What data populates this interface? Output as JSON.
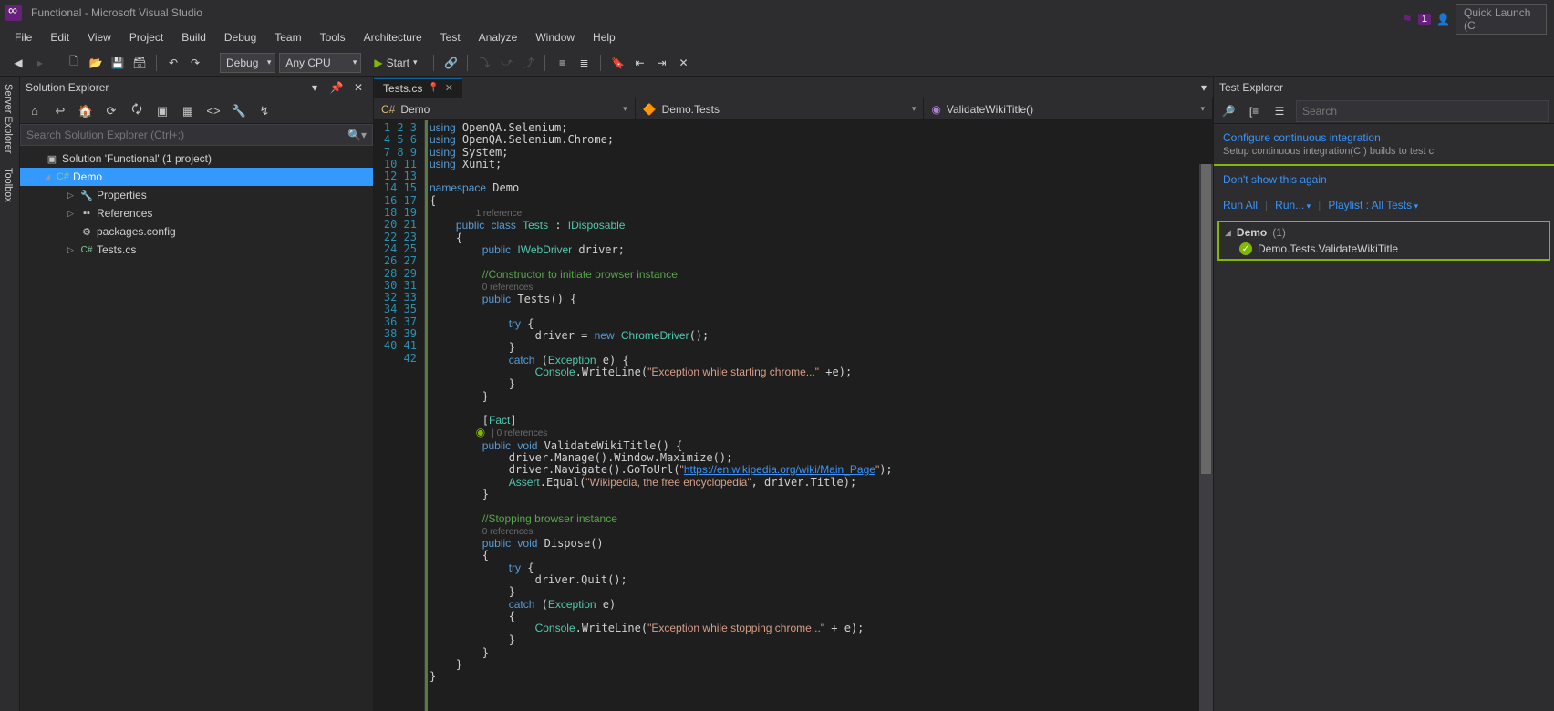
{
  "title": "Functional - Microsoft Visual Studio",
  "top_right": {
    "flag_badge": "1",
    "quick_launch": "Quick Launch (C"
  },
  "menu": [
    "File",
    "Edit",
    "View",
    "Project",
    "Build",
    "Debug",
    "Team",
    "Tools",
    "Architecture",
    "Test",
    "Analyze",
    "Window",
    "Help"
  ],
  "toolbar": {
    "config": "Debug",
    "platform": "Any CPU",
    "start_label": "Start"
  },
  "vertical_tabs": [
    "Server Explorer",
    "Toolbox"
  ],
  "solution_explorer": {
    "title": "Solution Explorer",
    "search_placeholder": "Search Solution Explorer (Ctrl+;)",
    "root": "Solution 'Functional' (1 project)",
    "project": "Demo",
    "items": [
      "Properties",
      "References",
      "packages.config",
      "Tests.cs"
    ]
  },
  "editor": {
    "tab": "Tests.cs",
    "nav": {
      "project": "Demo",
      "ns": "Demo.Tests",
      "member": "ValidateWikiTitle()"
    },
    "ref_1": "1 reference",
    "ref_0a": "0 references",
    "ref_0b": "| 0 references",
    "ref_0c": "0 references",
    "ref_0d": "0 references",
    "url": "https://en.wikipedia.org/wiki/Main_Page",
    "str_exstart": "\"Exception while starting chrome...\"",
    "str_exstop": "\"Exception while stopping chrome...\"",
    "str_wiki": "\"Wikipedia, the free encyclopedia\""
  },
  "test_explorer": {
    "title": "Test Explorer",
    "search_placeholder": "Search",
    "ci_title": "Configure continuous integration",
    "ci_subtitle": "Setup continuous integration(CI) builds to test c",
    "dont_show": "Don't show this again",
    "run_all": "Run All",
    "run": "Run...",
    "playlist": "Playlist : All Tests",
    "group": "Demo",
    "group_count": "(1)",
    "test_name": "Demo.Tests.ValidateWikiTitle"
  }
}
